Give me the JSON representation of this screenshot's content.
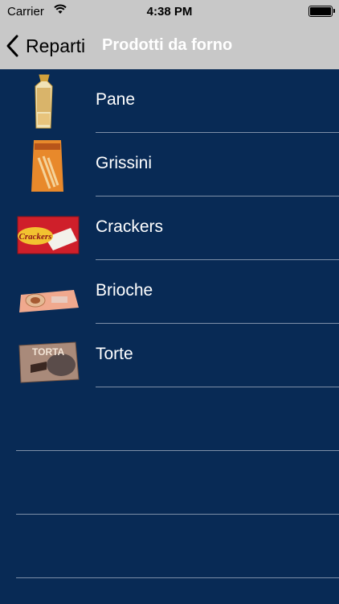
{
  "status_bar": {
    "carrier": "Carrier",
    "time": "4:38 PM",
    "battery_level": 1.0
  },
  "nav": {
    "back_label": "Reparti",
    "title": "Prodotti da forno"
  },
  "list": {
    "items": [
      {
        "label": "Pane",
        "icon": "bread-bag-icon"
      },
      {
        "label": "Grissini",
        "icon": "grissini-pack-icon"
      },
      {
        "label": "Crackers",
        "icon": "crackers-pack-icon",
        "thumb_text": "Crackers"
      },
      {
        "label": "Brioche",
        "icon": "brioche-pack-icon"
      },
      {
        "label": "Torte",
        "icon": "torte-pack-icon",
        "thumb_text": "TORTA"
      }
    ]
  },
  "colors": {
    "header_bg": "#c8c8c8",
    "list_bg": "#082a55",
    "separator": "#7d8fa8",
    "title_text": "#ffffff"
  }
}
